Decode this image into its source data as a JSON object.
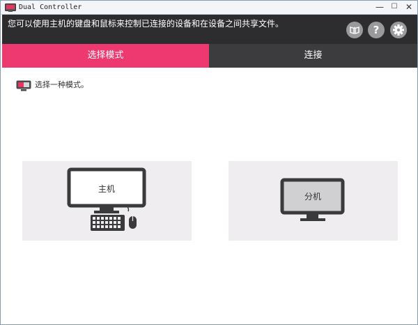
{
  "window": {
    "title": "Dual Controller",
    "minimize_glyph": "—",
    "maximize_glyph": "☐",
    "close_glyph": "✕"
  },
  "header": {
    "description": "您可以使用主机的键盘和鼠标来控制已连接的设备和在设备之间共享文件。",
    "help_glyph": "?"
  },
  "tabs": [
    {
      "label": "选择模式",
      "active": true,
      "color": "#ee3870"
    },
    {
      "label": "连接",
      "active": false,
      "color": "#3c3c3e"
    }
  ],
  "main": {
    "hint": "选择一种模式。",
    "modes": [
      {
        "label": "主机",
        "icon": "desktop-with-keyboard-mouse-icon"
      },
      {
        "label": "分机",
        "icon": "monitor-icon"
      }
    ]
  }
}
